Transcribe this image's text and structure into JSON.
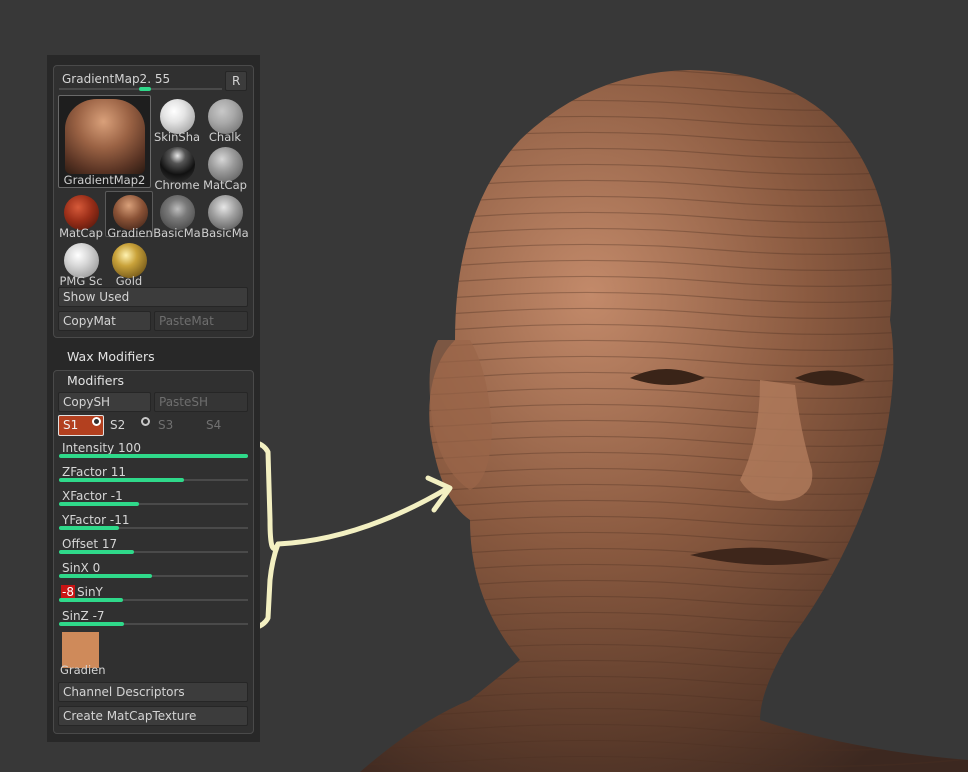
{
  "material": {
    "name": "GradientMap2.",
    "value": "55",
    "slider_fraction": 0.55,
    "r_button": "R",
    "preview_label": "GradientMap2",
    "swatches": [
      {
        "label": "SkinSha",
        "icon": "skinshade-material-icon"
      },
      {
        "label": "Chalk",
        "icon": "chalk-material-icon"
      },
      {
        "label": "Chrome",
        "icon": "chrome-material-icon"
      },
      {
        "label": "MatCap",
        "icon": "matcap-gray-material-icon"
      },
      {
        "label": "MatCap",
        "icon": "matcap-red-material-icon"
      },
      {
        "label": "Gradien",
        "icon": "gradient-material-icon"
      },
      {
        "label": "BasicMa",
        "icon": "basic-material-icon"
      },
      {
        "label": "BasicMa",
        "icon": "basic-material-2-icon"
      },
      {
        "label": "PMG Sc",
        "icon": "pmg-scratch-material-icon"
      },
      {
        "label": "Gold",
        "icon": "gold-material-icon"
      }
    ],
    "show_used": "Show Used",
    "copy_mat": "CopyMat",
    "paste_mat": "PasteMat"
  },
  "wax_modifiers": "Wax Modifiers",
  "modifiers": {
    "title": "Modifiers",
    "copy_sh": "CopySH",
    "paste_sh": "PasteSH",
    "shaders": [
      "S1",
      "S2",
      "S3",
      "S4"
    ],
    "sliders": [
      {
        "label": "Intensity 100",
        "fraction": 1.0
      },
      {
        "label": "ZFactor 11",
        "fraction": 0.66
      },
      {
        "label": "XFactor -1",
        "fraction": 0.42
      },
      {
        "label": "YFactor -11",
        "fraction": 0.32
      },
      {
        "label": "Offset 17",
        "fraction": 0.4
      },
      {
        "label": "SinX 0",
        "fraction": 0.49
      },
      {
        "label": "SinY",
        "prefix": "-8",
        "fraction": 0.34
      },
      {
        "label": "SinZ -7",
        "fraction": 0.34
      }
    ],
    "gradient_label": "Gradien",
    "gradient_color": "#cf8a5a",
    "channel_descriptors": "Channel Descriptors",
    "create_matcap": "Create MatCapTexture"
  },
  "colors": {
    "accent": "#2fd98a",
    "selected_shader": "#b3401f",
    "annotation": "#f3f0c2"
  }
}
